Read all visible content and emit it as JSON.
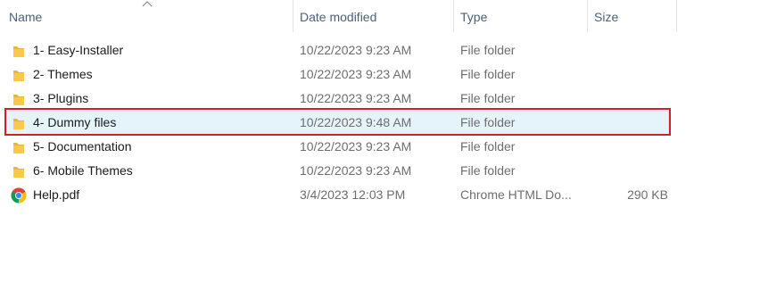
{
  "columns": {
    "name": "Name",
    "date_modified": "Date modified",
    "type": "Type",
    "size": "Size"
  },
  "sort": {
    "column": "name",
    "direction": "ascending",
    "icon": "chevron-up-icon"
  },
  "files": [
    {
      "name": "1- Easy-Installer",
      "date_modified": "10/22/2023 9:23 AM",
      "type": "File folder",
      "size": "",
      "icon": "folder-icon"
    },
    {
      "name": "2- Themes",
      "date_modified": "10/22/2023 9:23 AM",
      "type": "File folder",
      "size": "",
      "icon": "folder-icon"
    },
    {
      "name": "3- Plugins",
      "date_modified": "10/22/2023 9:23 AM",
      "type": "File folder",
      "size": "",
      "icon": "folder-icon"
    },
    {
      "name": "4- Dummy files",
      "date_modified": "10/22/2023 9:48 AM",
      "type": "File folder",
      "size": "",
      "icon": "folder-icon",
      "selected": true,
      "highlighted": true
    },
    {
      "name": "5- Documentation",
      "date_modified": "10/22/2023 9:23 AM",
      "type": "File folder",
      "size": "",
      "icon": "folder-icon"
    },
    {
      "name": "6- Mobile Themes",
      "date_modified": "10/22/2023 9:23 AM",
      "type": "File folder",
      "size": "",
      "icon": "folder-icon"
    },
    {
      "name": "Help.pdf",
      "date_modified": "3/4/2023 12:03 PM",
      "type": "Chrome HTML Do...",
      "size": "290 KB",
      "icon": "chrome-icon"
    }
  ],
  "colors": {
    "header_text": "#4c607a",
    "selection_bg": "#e5f3fb",
    "highlight_border": "#d0202a",
    "folder_yellow": "#f8c94a"
  }
}
